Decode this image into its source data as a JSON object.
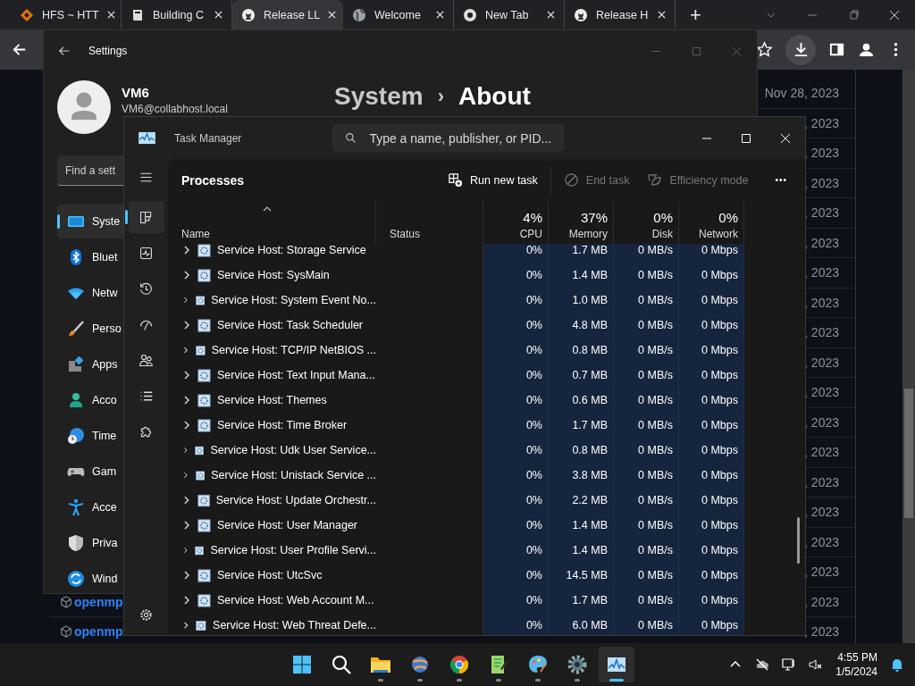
{
  "browser": {
    "tabs": [
      {
        "title": "HFS ~ HTT",
        "kind": "diamond",
        "selected": false
      },
      {
        "title": "Building C",
        "kind": "book",
        "selected": false
      },
      {
        "title": "Release LL",
        "kind": "github",
        "selected": true
      },
      {
        "title": "Welcome",
        "kind": "globe",
        "selected": false
      },
      {
        "title": "New Tab",
        "kind": "chrome",
        "selected": false
      },
      {
        "title": "Release H",
        "kind": "github",
        "selected": false
      }
    ],
    "new_tab": "+",
    "rows": [
      {
        "date": "Nov 28, 2023"
      },
      {
        "date": ", 2023"
      },
      {
        "date": ", 2023"
      },
      {
        "date": ", 2023"
      },
      {
        "date": ", 2023"
      },
      {
        "date": ", 2023"
      },
      {
        "date": ", 2023"
      },
      {
        "date": ", 2023"
      },
      {
        "date": ", 2023"
      },
      {
        "date": ", 2023"
      },
      {
        "date": ", 2023"
      },
      {
        "date": ", 2023"
      },
      {
        "date": ", 2023"
      },
      {
        "date": ", 2023"
      },
      {
        "date": ", 2023"
      },
      {
        "date": ", 2023"
      },
      {
        "date": ", 2023"
      },
      {
        "link": "openmp",
        "date": ", 2023"
      },
      {
        "link": "openmp",
        "date": ", 2023"
      }
    ]
  },
  "settings": {
    "title": "Settings",
    "user": {
      "name": "VM6",
      "email": "VM6@collabhost.local"
    },
    "breadcrumb": {
      "parent": "System",
      "separator": "›",
      "current": "About"
    },
    "search": {
      "placeholder": "Find a sett"
    },
    "nav": [
      {
        "label": "Syste",
        "kind": "system",
        "selected": true
      },
      {
        "label": "Bluet",
        "kind": "bluetooth",
        "selected": false
      },
      {
        "label": "Netw",
        "kind": "network",
        "selected": false
      },
      {
        "label": "Perso",
        "kind": "brush",
        "selected": false
      },
      {
        "label": "Apps",
        "kind": "apps",
        "selected": false
      },
      {
        "label": "Acco",
        "kind": "accounts",
        "selected": false
      },
      {
        "label": "Time",
        "kind": "time",
        "selected": false
      },
      {
        "label": "Gam",
        "kind": "gaming",
        "selected": false
      },
      {
        "label": "Acce",
        "kind": "accessibility",
        "selected": false
      },
      {
        "label": "Priva",
        "kind": "privacy",
        "selected": false
      },
      {
        "label": "Wind",
        "kind": "update",
        "selected": false
      }
    ]
  },
  "task_manager": {
    "title": "Task Manager",
    "search": {
      "placeholder": "Type a name, publisher, or PID..."
    },
    "rail": [
      {
        "kind": "processes",
        "selected": true
      },
      {
        "kind": "performance",
        "selected": false
      },
      {
        "kind": "history",
        "selected": false
      },
      {
        "kind": "startup",
        "selected": false
      },
      {
        "kind": "users",
        "selected": false
      },
      {
        "kind": "details",
        "selected": false
      },
      {
        "kind": "services",
        "selected": false
      }
    ],
    "page_title": "Processes",
    "actions": [
      {
        "label": "Run new task",
        "kind": "run",
        "disabled": false
      },
      {
        "label": "End task",
        "kind": "end",
        "disabled": true
      },
      {
        "label": "Efficiency mode",
        "kind": "leaf",
        "disabled": true
      }
    ],
    "more": "•••",
    "columns": [
      {
        "label": "Name",
        "kind": "text"
      },
      {
        "label": "Status",
        "kind": "text"
      },
      {
        "label": "CPU",
        "total": "4%",
        "kind": "metric"
      },
      {
        "label": "Memory",
        "total": "37%",
        "kind": "metric"
      },
      {
        "label": "Disk",
        "total": "0%",
        "kind": "metric"
      },
      {
        "label": "Network",
        "total": "0%",
        "kind": "metric"
      }
    ],
    "rows": [
      {
        "name": "Service Host: Storage Service",
        "cpu": "0%",
        "memory": "1.7 MB",
        "disk": "0 MB/s",
        "network": "0 Mbps"
      },
      {
        "name": "Service Host: SysMain",
        "cpu": "0%",
        "memory": "1.4 MB",
        "disk": "0 MB/s",
        "network": "0 Mbps"
      },
      {
        "name": "Service Host: System Event No...",
        "cpu": "0%",
        "memory": "1.0 MB",
        "disk": "0 MB/s",
        "network": "0 Mbps"
      },
      {
        "name": "Service Host: Task Scheduler",
        "cpu": "0%",
        "memory": "4.8 MB",
        "disk": "0 MB/s",
        "network": "0 Mbps"
      },
      {
        "name": "Service Host: TCP/IP NetBIOS ...",
        "cpu": "0%",
        "memory": "0.8 MB",
        "disk": "0 MB/s",
        "network": "0 Mbps"
      },
      {
        "name": "Service Host: Text Input Mana...",
        "cpu": "0%",
        "memory": "0.7 MB",
        "disk": "0 MB/s",
        "network": "0 Mbps"
      },
      {
        "name": "Service Host: Themes",
        "cpu": "0%",
        "memory": "0.6 MB",
        "disk": "0 MB/s",
        "network": "0 Mbps"
      },
      {
        "name": "Service Host: Time Broker",
        "cpu": "0%",
        "memory": "1.7 MB",
        "disk": "0 MB/s",
        "network": "0 Mbps"
      },
      {
        "name": "Service Host: Udk User Service...",
        "cpu": "0%",
        "memory": "0.8 MB",
        "disk": "0 MB/s",
        "network": "0 Mbps"
      },
      {
        "name": "Service Host: Unistack Service ...",
        "cpu": "0%",
        "memory": "3.8 MB",
        "disk": "0 MB/s",
        "network": "0 Mbps"
      },
      {
        "name": "Service Host: Update Orchestr...",
        "cpu": "0%",
        "memory": "2.2 MB",
        "disk": "0 MB/s",
        "network": "0 Mbps"
      },
      {
        "name": "Service Host: User Manager",
        "cpu": "0%",
        "memory": "1.4 MB",
        "disk": "0 MB/s",
        "network": "0 Mbps"
      },
      {
        "name": "Service Host: User Profile Servi...",
        "cpu": "0%",
        "memory": "1.4 MB",
        "disk": "0 MB/s",
        "network": "0 Mbps"
      },
      {
        "name": "Service Host: UtcSvc",
        "cpu": "0%",
        "memory": "14.5 MB",
        "disk": "0 MB/s",
        "network": "0 Mbps"
      },
      {
        "name": "Service Host: Web Account M...",
        "cpu": "0%",
        "memory": "1.7 MB",
        "disk": "0 MB/s",
        "network": "0 Mbps"
      },
      {
        "name": "Service Host: Web Threat Defe...",
        "cpu": "0%",
        "memory": "6.0 MB",
        "disk": "0 MB/s",
        "network": "0 Mbps"
      }
    ]
  },
  "taskbar": {
    "apps": [
      {
        "kind": "start",
        "running": false,
        "selected": false
      },
      {
        "kind": "search",
        "running": false,
        "selected": false
      },
      {
        "kind": "folder",
        "running": true,
        "selected": false
      },
      {
        "kind": "globe",
        "running": true,
        "selected": false
      },
      {
        "kind": "chrome",
        "running": true,
        "selected": false
      },
      {
        "kind": "notepad",
        "running": true,
        "selected": false
      },
      {
        "kind": "palette",
        "running": true,
        "selected": false
      },
      {
        "kind": "settings",
        "running": true,
        "selected": false
      },
      {
        "kind": "taskmgr",
        "running": true,
        "selected": true
      }
    ],
    "time": "4:55 PM",
    "date": "1/5/2024"
  }
}
